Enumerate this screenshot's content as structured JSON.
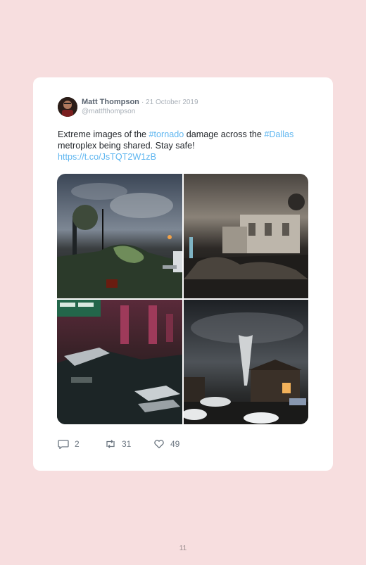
{
  "tweet": {
    "author_name": "Matt Thompson",
    "date": "· 21 October 2019",
    "handle": "@mattfthompson",
    "text_part1": "Extreme images of the ",
    "hashtag1": "#tornado",
    "text_part2": " damage across the ",
    "hashtag2": "#Dallas",
    "text_part3": " metroplex being shared. Stay safe!",
    "link": "https://t.co/JsTQT2W1zB",
    "photos": [
      {
        "icon": "photo-storm-debris-street"
      },
      {
        "icon": "photo-damaged-house-night"
      },
      {
        "icon": "photo-flooded-highway-wreck"
      },
      {
        "icon": "photo-tornado-funnel-night"
      }
    ],
    "actions": {
      "reply_count": "2",
      "retweet_count": "31",
      "like_count": "49"
    },
    "colors": {
      "accent": "#5fb6f0",
      "background": "#f7dedf"
    }
  },
  "page": {
    "number": "11"
  }
}
